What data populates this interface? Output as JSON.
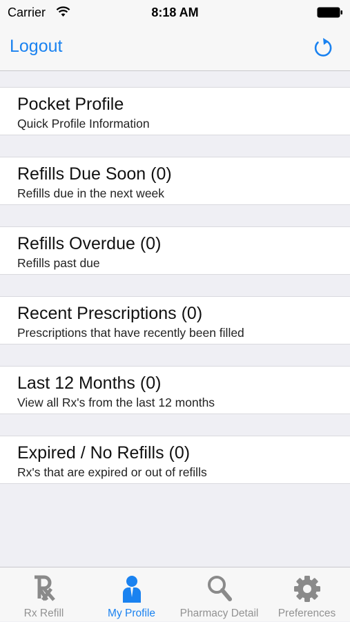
{
  "status_bar": {
    "carrier": "Carrier",
    "time": "8:18 AM"
  },
  "nav": {
    "left_button": "Logout",
    "right_icon": "refresh-icon"
  },
  "rows": [
    {
      "title": "Pocket Profile",
      "subtitle": "Quick Profile Information"
    },
    {
      "title": "Refills Due Soon (0)",
      "subtitle": "Refills due in the next week"
    },
    {
      "title": "Refills Overdue (0)",
      "subtitle": "Refills past due"
    },
    {
      "title": "Recent Prescriptions (0)",
      "subtitle": "Prescriptions that have recently been filled"
    },
    {
      "title": "Last 12 Months (0)",
      "subtitle": "View all Rx's from the last 12 months"
    },
    {
      "title": "Expired / No Refills (0)",
      "subtitle": "Rx's that are expired or out of refills"
    }
  ],
  "tabs": [
    {
      "label": "Rx Refill",
      "icon": "rx-icon"
    },
    {
      "label": "My Profile",
      "icon": "person-icon",
      "active": true
    },
    {
      "label": "Pharmacy Detail",
      "icon": "magnifier-icon"
    },
    {
      "label": "Preferences",
      "icon": "gear-icon"
    }
  ],
  "colors": {
    "accent": "#1a82f0",
    "inactive": "#929292",
    "background": "#efeff4"
  }
}
